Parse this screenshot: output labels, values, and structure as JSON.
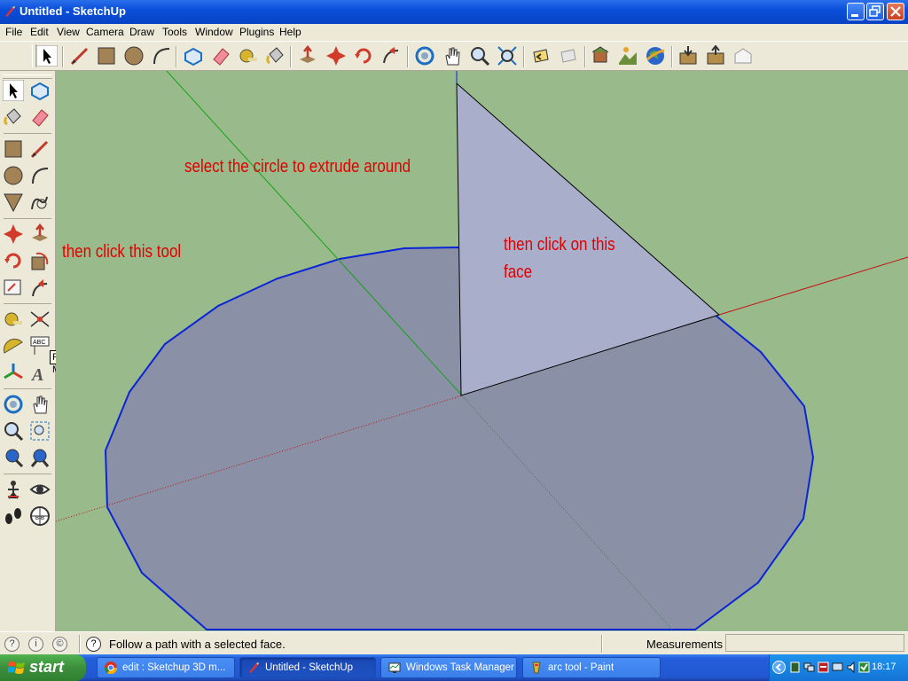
{
  "window": {
    "title": "Untitled - SketchUp"
  },
  "menu": [
    "File",
    "Edit",
    "View",
    "Camera",
    "Draw",
    "Tools",
    "Window",
    "Plugins",
    "Help"
  ],
  "annotations": {
    "select_circle": "select the circle to extrude around",
    "click_tool": "then click this tool",
    "click_face_line1": "then click on this",
    "click_face_line2": "face"
  },
  "tooltip": "Follow Me",
  "status": {
    "message": "Follow a path with a selected face.",
    "measurements_label": "Measurements",
    "measurements_value": "",
    "icons": [
      "geo-location-icon",
      "credits-icon",
      "copyright-icon",
      "help-icon"
    ]
  },
  "taskbar": {
    "start": "start",
    "tasks": [
      {
        "label": "edit : Sketchup 3D m...",
        "icon": "chrome-icon"
      },
      {
        "label": "Untitled - SketchUp",
        "icon": "sketchup-icon",
        "active": true
      },
      {
        "label": "Windows Task Manager",
        "icon": "task-manager-icon"
      },
      {
        "label": "arc tool - Paint",
        "icon": "paint-icon"
      }
    ],
    "clock": "18:17"
  },
  "colors": {
    "viewport_bg": "#99bb8c",
    "circle_fill": "#8a90a5",
    "triangle_fill": "#a9aecb",
    "circle_edge": "#0b25d6",
    "annotation": "#e10000"
  }
}
